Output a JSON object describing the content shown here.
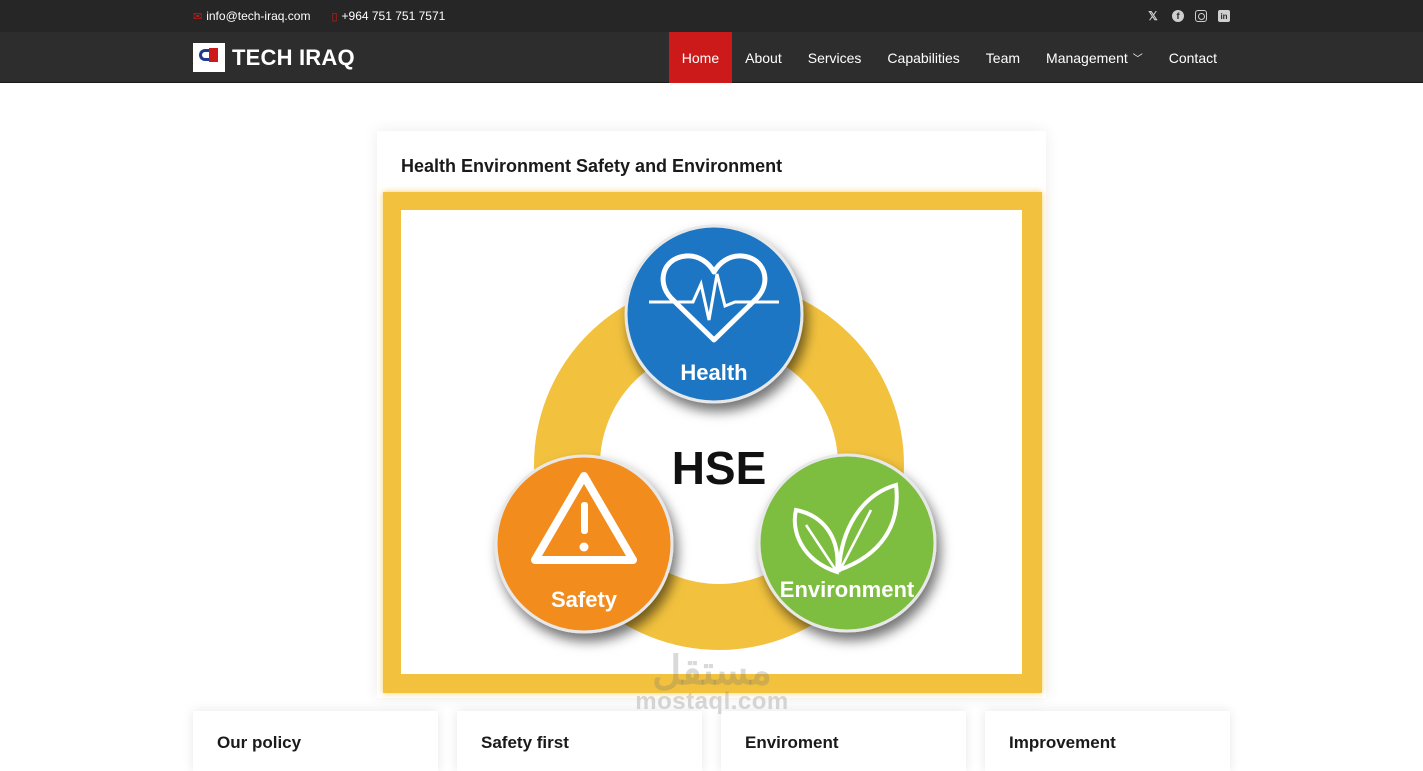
{
  "topbar": {
    "email": "info@tech-iraq.com",
    "phone": "+964 751 751 7571",
    "social": [
      "x-icon",
      "facebook-icon",
      "instagram-icon",
      "linkedin-icon"
    ]
  },
  "brand": {
    "name": "TECH IRAQ"
  },
  "nav": {
    "items": [
      {
        "label": "Home",
        "active": true
      },
      {
        "label": "About"
      },
      {
        "label": "Services"
      },
      {
        "label": "Capabilities"
      },
      {
        "label": "Team"
      },
      {
        "label": "Management",
        "dropdown": true
      },
      {
        "label": "Contact"
      }
    ]
  },
  "main": {
    "title": "Health Environment Safety and Environment",
    "diagram": {
      "center": "HSE",
      "health": "Health",
      "safety": "Safety",
      "environment": "Environment"
    }
  },
  "features": [
    {
      "title": "Our policy"
    },
    {
      "title": "Safety first"
    },
    {
      "title": "Enviroment"
    },
    {
      "title": "Improvement"
    }
  ],
  "watermark": {
    "arabic": "مستقل",
    "latin": "mostaql.com"
  },
  "colors": {
    "accent": "#cc1a1a",
    "topbar": "#262626",
    "navbar": "#2d2d2d",
    "frame": "#f2c23e",
    "health": "#1f76c4",
    "safety": "#f28c1e",
    "environment": "#7dbd3f"
  }
}
